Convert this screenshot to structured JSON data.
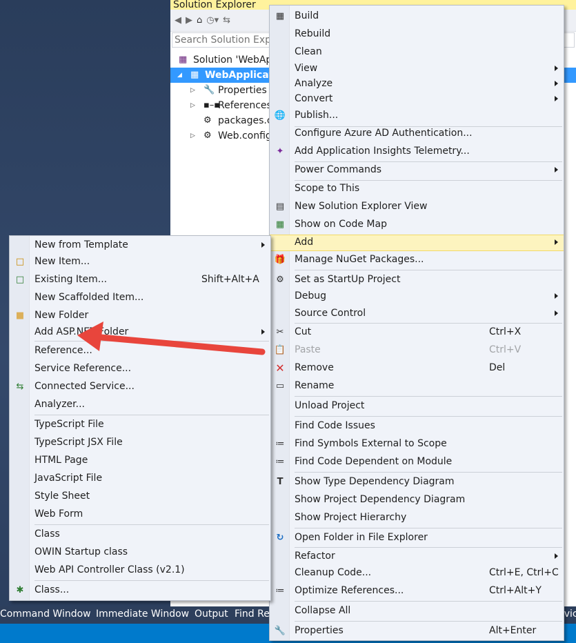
{
  "solution_explorer": {
    "title": "Solution Explorer",
    "search_placeholder": "Search Solution Explo",
    "tree": [
      {
        "label": "Solution 'WebAp",
        "selected": false
      },
      {
        "label": "WebApplicati",
        "selected": true
      },
      {
        "label": "Properties",
        "selected": false
      },
      {
        "label": "References",
        "selected": false
      },
      {
        "label": "packages.co",
        "selected": false
      },
      {
        "label": "Web.config",
        "selected": false
      }
    ]
  },
  "context_menu": {
    "items": [
      {
        "label": "Build",
        "icon": "build-icon"
      },
      {
        "label": "Rebuild"
      },
      {
        "label": "Clean"
      },
      {
        "label": "View",
        "submenu": true
      },
      {
        "label": "Analyze",
        "submenu": true
      },
      {
        "label": "Convert",
        "submenu": true
      },
      {
        "label": "Publish...",
        "icon": "publish-icon"
      },
      {
        "label": "Configure Azure AD Authentication..."
      },
      {
        "label": "Add Application Insights Telemetry...",
        "icon": "insights-icon"
      },
      {
        "label": "Power Commands",
        "submenu": true
      },
      {
        "label": "Scope to This"
      },
      {
        "label": "New Solution Explorer View",
        "icon": "new-view-icon"
      },
      {
        "label": "Show on Code Map",
        "icon": "code-map-icon"
      },
      {
        "label": "Add",
        "submenu": true,
        "highlighted": true
      },
      {
        "label": "Manage NuGet Packages...",
        "icon": "nuget-icon"
      },
      {
        "label": "Set as StartUp Project",
        "icon": "gear-icon"
      },
      {
        "label": "Debug",
        "submenu": true
      },
      {
        "label": "Source Control",
        "submenu": true
      },
      {
        "label": "Cut",
        "shortcut": "Ctrl+X",
        "icon": "scissors-icon"
      },
      {
        "label": "Paste",
        "shortcut": "Ctrl+V",
        "disabled": true,
        "icon": "paste-icon"
      },
      {
        "label": "Remove",
        "shortcut": "Del",
        "icon": "remove-icon"
      },
      {
        "label": "Rename",
        "icon": "rename-icon"
      },
      {
        "label": "Unload Project"
      },
      {
        "label": "Find Code Issues"
      },
      {
        "label": "Find Symbols External to Scope",
        "icon": "find-symbols-icon"
      },
      {
        "label": "Find Code Dependent on Module",
        "icon": "find-dependent-icon"
      },
      {
        "label": "Show Type Dependency Diagram",
        "icon": "type-diagram-icon"
      },
      {
        "label": "Show Project Dependency Diagram"
      },
      {
        "label": "Show Project Hierarchy"
      },
      {
        "label": "Open Folder in File Explorer",
        "icon": "open-folder-icon"
      },
      {
        "label": "Refactor",
        "submenu": true
      },
      {
        "label": "Cleanup Code...",
        "shortcut": "Ctrl+E, Ctrl+C"
      },
      {
        "label": "Optimize References...",
        "shortcut": "Ctrl+Alt+Y",
        "icon": "optimize-icon"
      },
      {
        "label": "Collapse All"
      },
      {
        "label": "Properties",
        "shortcut": "Alt+Enter",
        "icon": "wrench-icon"
      }
    ]
  },
  "add_submenu": {
    "items": [
      {
        "label": "New from Template",
        "submenu": true
      },
      {
        "label": "New Item...",
        "icon": "new-item-icon"
      },
      {
        "label": "Existing Item...",
        "shortcut": "Shift+Alt+A",
        "icon": "existing-item-icon"
      },
      {
        "label": "New Scaffolded Item..."
      },
      {
        "label": "New Folder",
        "icon": "folder-icon"
      },
      {
        "label": "Add ASP.NET Folder",
        "submenu": true
      },
      {
        "label": "Reference..."
      },
      {
        "label": "Service Reference..."
      },
      {
        "label": "Connected Service...",
        "icon": "connected-service-icon"
      },
      {
        "label": "Analyzer..."
      },
      {
        "label": "TypeScript File"
      },
      {
        "label": "TypeScript JSX File"
      },
      {
        "label": "HTML Page"
      },
      {
        "label": "JavaScript File"
      },
      {
        "label": "Style Sheet"
      },
      {
        "label": "Web Form"
      },
      {
        "label": "Class"
      },
      {
        "label": "OWIN Startup class"
      },
      {
        "label": "Web API Controller Class (v2.1)"
      },
      {
        "label": "Class...",
        "icon": "class-wizard-icon"
      }
    ]
  },
  "bottom_tabs": [
    "Command Window",
    "Immediate Window",
    "Output",
    "Find Re",
    "rvic"
  ],
  "colors": {
    "selection": "#3399ff",
    "menu_background": "#f0f3f9",
    "highlight": "#fdf4bf",
    "status_bar": "#007acc",
    "annotation_arrow": "#e8453c",
    "title_bar": "#fff29d"
  }
}
